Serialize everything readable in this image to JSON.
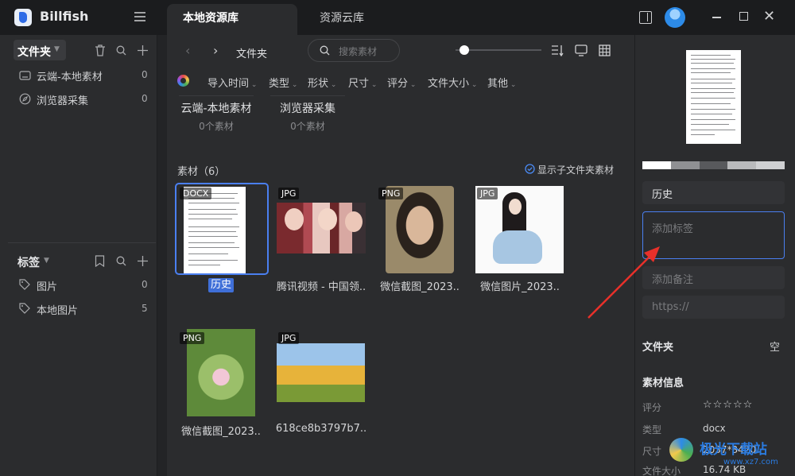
{
  "app": {
    "name": "Billfish"
  },
  "tabs": [
    {
      "label": "本地资源库"
    },
    {
      "label": "资源云库"
    }
  ],
  "sidebar": {
    "folders_title": "文件夹",
    "folders": [
      {
        "label": "云端-本地素材",
        "count": "0",
        "icon": "cloud-icon"
      },
      {
        "label": "浏览器采集",
        "count": "0",
        "icon": "compass-icon"
      }
    ],
    "tags_title": "标签",
    "tags": [
      {
        "label": "图片",
        "count": "0",
        "icon": "tag-icon"
      },
      {
        "label": "本地图片",
        "count": "5",
        "icon": "tag-icon"
      }
    ]
  },
  "toolbar": {
    "breadcrumb": "文件夹",
    "search_placeholder": "搜索素材"
  },
  "filters": [
    "导入时间",
    "类型",
    "形状",
    "尺寸",
    "评分",
    "文件大小",
    "其他"
  ],
  "subfolders": [
    {
      "name": "云端-本地素材",
      "count": "0个素材"
    },
    {
      "name": "浏览器采集",
      "count": "0个素材"
    }
  ],
  "assets_header": {
    "title": "素材（6）",
    "show_sub": "显示子文件夹素材"
  },
  "assets": [
    {
      "type": "DOCX",
      "name": "历史"
    },
    {
      "type": "JPG",
      "name": "腾讯视频 - 中国领.."
    },
    {
      "type": "PNG",
      "name": "微信截图_2023.."
    },
    {
      "type": "JPG",
      "name": "微信图片_2023.."
    },
    {
      "type": "PNG",
      "name": "微信截图_2023.."
    },
    {
      "type": "JPG",
      "name": "618ce8b3797b7.."
    }
  ],
  "inspector": {
    "name_value": "历史",
    "tags_placeholder": "添加标签",
    "note_placeholder": "添加备注",
    "url_placeholder": "https://",
    "folder_label": "文件夹",
    "folder_value": "空",
    "info_title": "素材信息",
    "rating_label": "评分",
    "rating_stars": "☆☆☆☆☆",
    "type_label": "类型",
    "type_value": "docx",
    "size_label": "尺寸",
    "size_value": "2037*3420",
    "filesize_label": "文件大小",
    "filesize_value": "16.74 KB",
    "palette": [
      "#ffffff",
      "#8f9093",
      "#58595c",
      "#b9babc",
      "#cfd0d2"
    ]
  },
  "watermark": {
    "text": "极光下载站",
    "url": "www.xz7.com"
  }
}
